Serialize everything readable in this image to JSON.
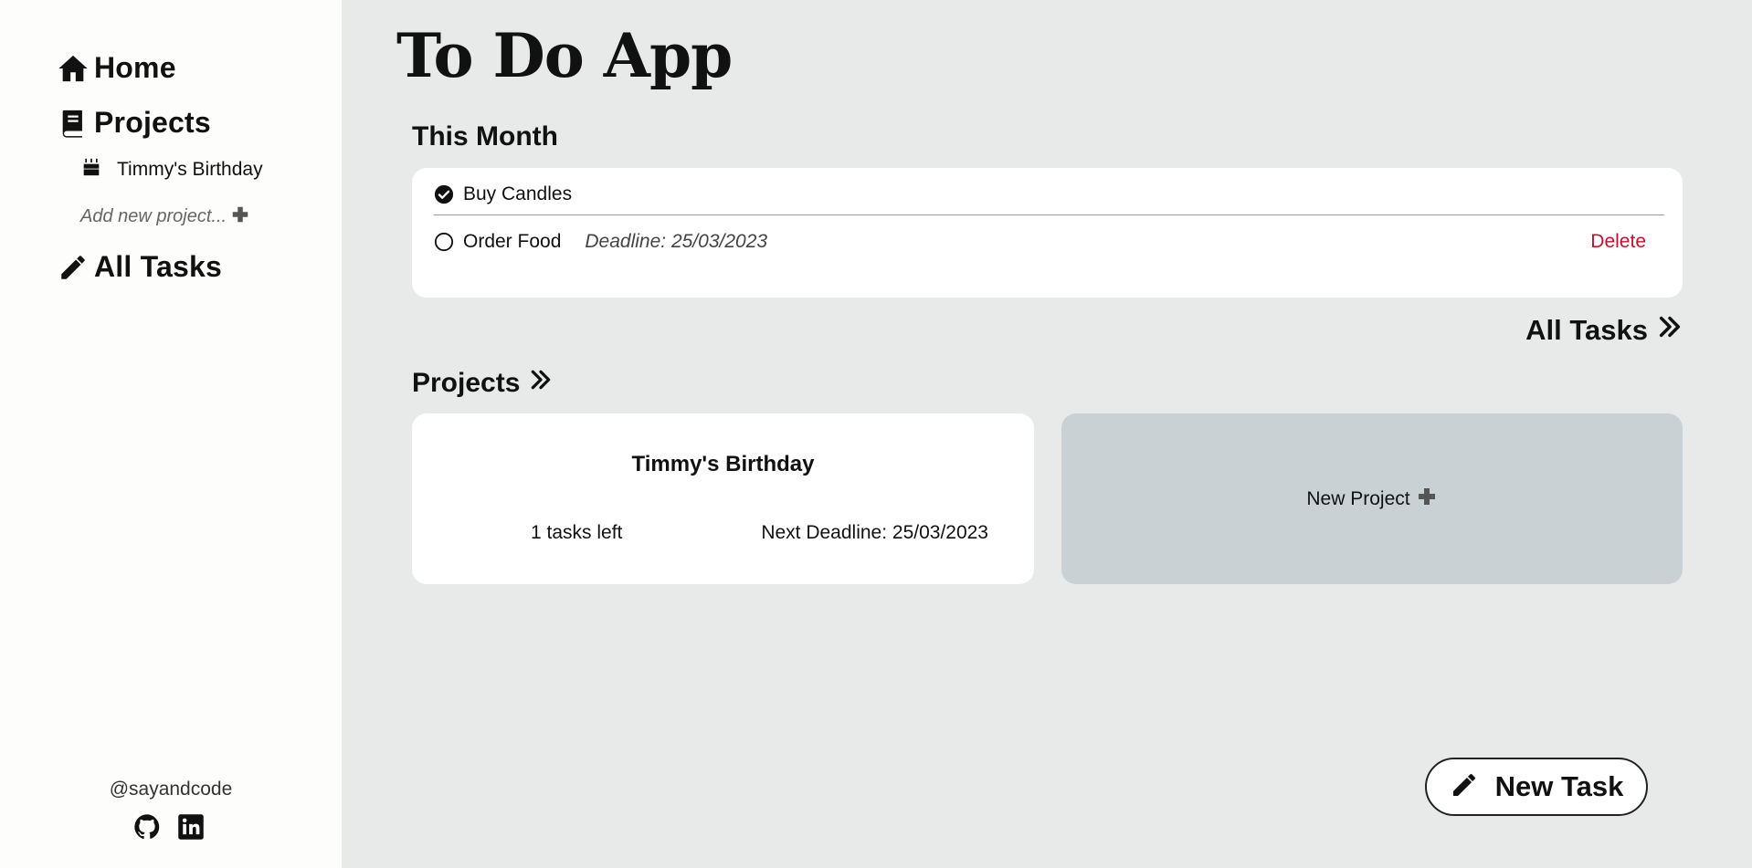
{
  "app": {
    "title": "To Do App"
  },
  "sidebar": {
    "nav": {
      "home": "Home",
      "projects": "Projects",
      "all_tasks": "All Tasks"
    },
    "project_items": [
      {
        "label": "Timmy's Birthday",
        "icon": "birthday-cake-icon"
      }
    ],
    "add_project_label": "Add new project...",
    "footer": {
      "handle": "@sayandcode",
      "links": [
        "github-icon",
        "linkedin-icon"
      ]
    }
  },
  "main": {
    "this_month": {
      "heading": "This Month",
      "tasks": [
        {
          "title": "Buy Candles",
          "done": true,
          "deadline": ""
        },
        {
          "title": "Order Food",
          "done": false,
          "deadline": "Deadline: 25/03/2023",
          "delete_label": "Delete"
        }
      ]
    },
    "all_tasks_link": "All Tasks",
    "projects_heading": "Projects",
    "projects": [
      {
        "name": "Timmy's Birthday",
        "tasks_left": "1 tasks left",
        "next_deadline": "Next Deadline: 25/03/2023"
      }
    ],
    "new_project_label": "New Project",
    "new_task_label": "New Task"
  },
  "colors": {
    "sidebar_bg": "#fdfdfc",
    "main_bg": "#e8eaea",
    "card_bg": "#ffffff",
    "new_project_bg": "#c9d1d5",
    "delete_red": "#c8102e"
  }
}
